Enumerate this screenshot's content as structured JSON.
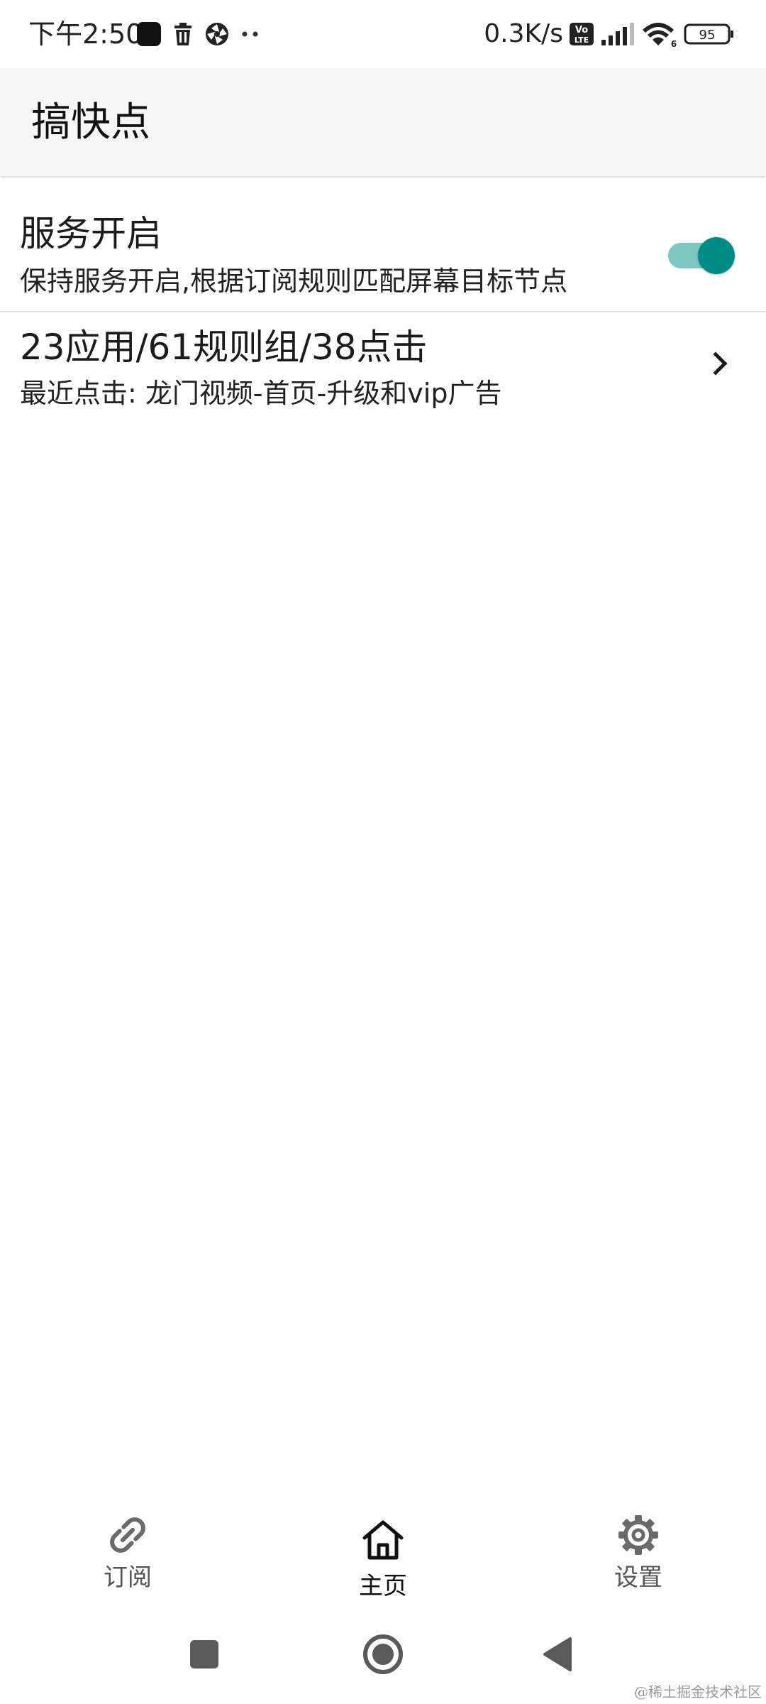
{
  "status_bar": {
    "time": "下午2:50",
    "net_speed": "0.3K/s",
    "battery": "95",
    "volte_top": "Vo",
    "volte_bottom": "LTE",
    "wifi_badge": "6"
  },
  "app_bar": {
    "title": "搞快点"
  },
  "service_row": {
    "title": "服务开启",
    "subtitle": "保持服务开启,根据订阅规则匹配屏幕目标节点",
    "enabled": true
  },
  "stats_row": {
    "title": "23应用/61规则组/38点击",
    "subtitle": "最近点击: 龙门视频-首页-升级和vip广告"
  },
  "bottom_nav": {
    "items": [
      {
        "label": "订阅",
        "icon": "link-icon",
        "selected": false
      },
      {
        "label": "主页",
        "icon": "home-icon",
        "selected": true
      },
      {
        "label": "设置",
        "icon": "gear-icon",
        "selected": false
      }
    ]
  },
  "watermark": "@稀土掘金技术社区",
  "colors": {
    "accent": "#008c86",
    "accent_track": "#7ec6c2",
    "app_bar_bg": "#f5f6f5"
  }
}
